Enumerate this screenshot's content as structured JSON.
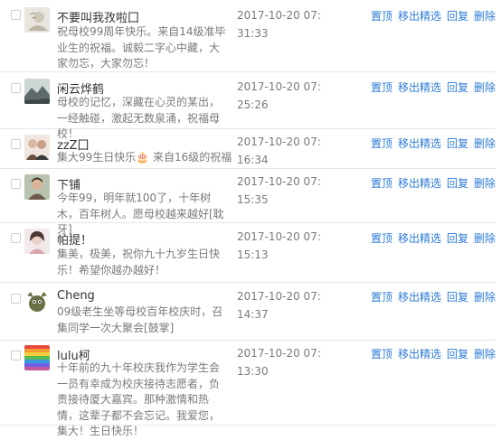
{
  "actions": {
    "pin": "置顶",
    "remove_featured": "移出精选",
    "reply": "回复",
    "delete": "删除"
  },
  "comments": [
    {
      "name": "不要叫我孜啦囗",
      "message": "祝母校99周年快乐。来自14级准毕业生的祝福。诚毅二字心中藏，大家勿忘，大家勿忘！",
      "time": "2017-10-20 07:31:33",
      "avatar": "sketch-avatar-icon"
    },
    {
      "name": "闲云烨鹤",
      "message": "母校的记忆，深藏在心灵的某出，一经触碰，激起无数泉涌，祝福母校！",
      "time": "2017-10-20 07:25:26",
      "avatar": "landscape-avatar-icon"
    },
    {
      "name": "zzZ囗",
      "message": "集大99生日快乐🎂 来自16级的祝福",
      "time": "2017-10-20 07:16:34",
      "avatar": "couple-avatar-icon"
    },
    {
      "name": "下铺",
      "message": "今年99，明年就100了，十年树木，百年树人。愿母校越来越好[耽牙]",
      "time": "2017-10-20 07:15:35",
      "avatar": "portrait-avatar-icon"
    },
    {
      "name": "帕提！",
      "message": "集美，极美，祝你九十九岁生日快乐！希望你越办越好！",
      "time": "2017-10-20 07:15:13",
      "avatar": "girl-avatar-icon"
    },
    {
      "name": "Cheng",
      "message": "09级老生坐等母校百年校庆时，召集同学一次大聚会[鼓掌]",
      "time": "2017-10-20 07:14:37",
      "avatar": "cartoon-avatar-icon"
    },
    {
      "name": "lulu柯",
      "message": "十年前的九十年校庆我作为学生会一员有幸成为校庆接待志愿者，负责接待厦大嘉宾。那种激情和热情，这辈子都不会忘记。我爱您，集大！生日快乐！",
      "time": "2017-10-20 07:13:30",
      "avatar": "rainbow-avatar-icon"
    }
  ]
}
